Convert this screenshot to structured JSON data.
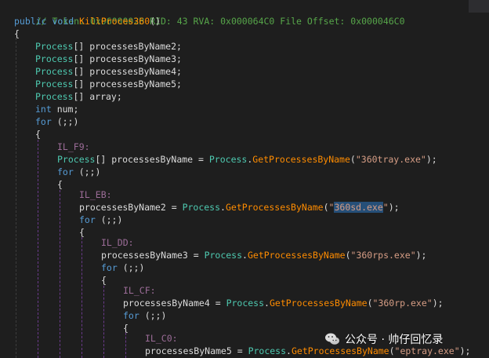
{
  "header_comment": "// Token: 0x0600002B RID: 43 RVA: 0x000064C0 File Offset: 0x000046C0",
  "signature": {
    "modifier": "public",
    "ret": "void",
    "name": "KillProces360",
    "parens": "()"
  },
  "open_brace": "{",
  "decls": [
    {
      "type": "Process",
      "rest": "[] processesByName2;"
    },
    {
      "type": "Process",
      "rest": "[] processesByName3;"
    },
    {
      "type": "Process",
      "rest": "[] processesByName4;"
    },
    {
      "type": "Process",
      "rest": "[] processesByName5;"
    },
    {
      "type": "Process",
      "rest": "[] array;"
    }
  ],
  "int_decl": {
    "kw": "int",
    "rest": " num;"
  },
  "for_kw": "for",
  "for_rest": " (;;)",
  "labels": [
    "IL_F9:",
    "IL_EB:",
    "IL_DD:",
    "IL_CF:",
    "IL_C0:"
  ],
  "assignments": [
    {
      "pre_type": "Process",
      "pre_rest": "[] processesByName = ",
      "recv": "Process",
      "dot": ".",
      "method": "GetProcessesByName",
      "open": "(",
      "str": "\"360tray.exe\"",
      "close": ");"
    },
    {
      "pre_type": "",
      "pre_rest": "processesByName2 = ",
      "recv": "Process",
      "dot": ".",
      "method": "GetProcessesByName",
      "open": "(",
      "str_q1": "\"",
      "str_sel": "360sd.exe",
      "str_q2": "\"",
      "close": ");"
    },
    {
      "pre_type": "",
      "pre_rest": "processesByName3 = ",
      "recv": "Process",
      "dot": ".",
      "method": "GetProcessesByName",
      "open": "(",
      "str": "\"360rps.exe\"",
      "close": ");"
    },
    {
      "pre_type": "",
      "pre_rest": "processesByName4 = ",
      "recv": "Process",
      "dot": ".",
      "method": "GetProcessesByName",
      "open": "(",
      "str": "\"360rp.exe\"",
      "close": ");"
    },
    {
      "pre_type": "",
      "pre_rest": "processesByName5 = ",
      "recv": "Process",
      "dot": ".",
      "method": "GetProcessesByName",
      "open": "(",
      "str": "\"eptray.exe\"",
      "close": ");"
    }
  ],
  "watermark": {
    "text": "公众号 · 帅仔回忆录"
  },
  "colors": {
    "background": "#1e1e1e",
    "keyword": "#569cd6",
    "type": "#4ec9b0",
    "method": "#ff8c00",
    "string": "#d69d85",
    "comment": "#57a64a",
    "label": "#c586c0",
    "selection": "#264f78"
  }
}
